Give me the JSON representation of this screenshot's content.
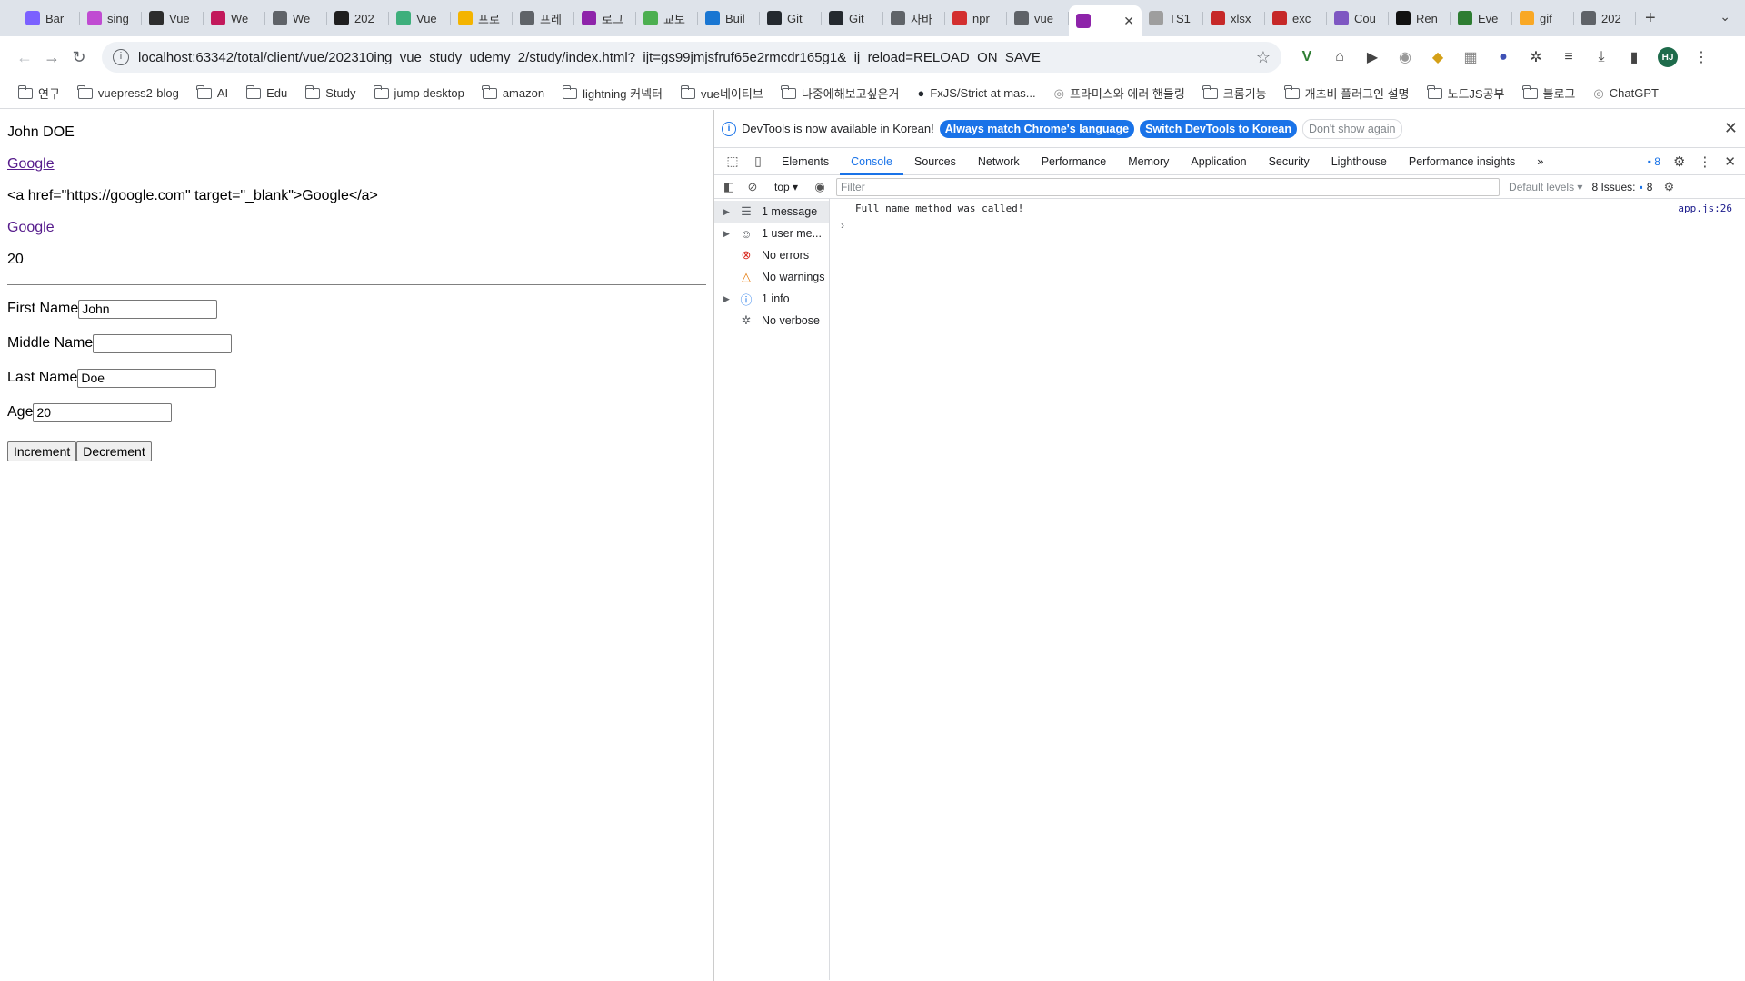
{
  "tabs": [
    {
      "label": "Bar",
      "color": "#7b61ff"
    },
    {
      "label": "sing",
      "color": "#c04bd2"
    },
    {
      "label": "Vue",
      "color": "#2d2d2d"
    },
    {
      "label": "We",
      "color": "#c2185b"
    },
    {
      "label": "We",
      "color": "#5f6368"
    },
    {
      "label": "202",
      "color": "#1f1f1f"
    },
    {
      "label": "Vue",
      "color": "#3eaf7c"
    },
    {
      "label": "프로",
      "color": "#f4b400"
    },
    {
      "label": "프레",
      "color": "#5f6368"
    },
    {
      "label": "로그",
      "color": "#8e24aa"
    },
    {
      "label": "교보",
      "color": "#4caf50"
    },
    {
      "label": "Buil",
      "color": "#1976d2"
    },
    {
      "label": "Git",
      "color": "#24292f"
    },
    {
      "label": "Git",
      "color": "#24292f"
    },
    {
      "label": "자바",
      "color": "#5f6368"
    },
    {
      "label": "npr",
      "color": "#d32f2f"
    },
    {
      "label": "vue",
      "color": "#5f6368"
    },
    {
      "label": "",
      "color": "#8e24aa",
      "active": true
    },
    {
      "label": "TS1",
      "color": "#9e9e9e"
    },
    {
      "label": "xlsx",
      "color": "#c62828"
    },
    {
      "label": "exc",
      "color": "#c62828"
    },
    {
      "label": "Cou",
      "color": "#7e57c2"
    },
    {
      "label": "Ren",
      "color": "#111111"
    },
    {
      "label": "Eve",
      "color": "#2e7d32"
    },
    {
      "label": "gif",
      "color": "#f9a825"
    },
    {
      "label": "202",
      "color": "#5f6368"
    }
  ],
  "address": {
    "url": "localhost:63342/total/client/vue/202310ing_vue_study_udemy_2/study/index.html?_ijt=gs99jmjsfruf65e2rmcdr165g1&_ij_reload=RELOAD_ON_SAVE"
  },
  "bookmarks": [
    {
      "label": "연구",
      "type": "folder"
    },
    {
      "label": "vuepress2-blog",
      "type": "folder"
    },
    {
      "label": "AI",
      "type": "folder"
    },
    {
      "label": "Edu",
      "type": "folder"
    },
    {
      "label": "Study",
      "type": "folder"
    },
    {
      "label": "jump desktop",
      "type": "folder"
    },
    {
      "label": "amazon",
      "type": "folder"
    },
    {
      "label": "lightning 커넥터",
      "type": "folder"
    },
    {
      "label": "vue네이티브",
      "type": "folder"
    },
    {
      "label": "나중에해보고싶은거",
      "type": "folder"
    },
    {
      "label": "FxJS/Strict at mas...",
      "type": "github"
    },
    {
      "label": "프라미스와 에러 핸들링",
      "type": "site"
    },
    {
      "label": "크롬기능",
      "type": "folder"
    },
    {
      "label": "개츠비 플러그인 설명",
      "type": "folder"
    },
    {
      "label": "노드JS공부",
      "type": "folder"
    },
    {
      "label": "블로그",
      "type": "folder"
    },
    {
      "label": "ChatGPT",
      "type": "site"
    }
  ],
  "page": {
    "full_name": "John DOE",
    "link1": "Google",
    "raw_html": "<a href=\"https://google.com\" target=\"_blank\">Google</a>",
    "link2": "Google",
    "age_display": "20",
    "first_label": "First Name",
    "first_value": "John",
    "middle_label": "Middle Name",
    "middle_value": "",
    "last_label": "Last Name",
    "last_value": "Doe",
    "age_label": "Age",
    "age_value": "20",
    "inc_label": "Increment",
    "dec_label": "Decrement"
  },
  "devtools": {
    "banner_text": "DevTools is now available in Korean!",
    "banner_btn1": "Always match Chrome's language",
    "banner_btn2": "Switch DevTools to Korean",
    "banner_btn3": "Don't show again",
    "tabs": [
      "Elements",
      "Console",
      "Sources",
      "Network",
      "Performance",
      "Memory",
      "Application",
      "Security",
      "Lighthouse",
      "Performance insights"
    ],
    "active_tab": "Console",
    "msg_count": "8",
    "context": "top",
    "filter_placeholder": "Filter",
    "levels": "Default levels",
    "issues_label": "8 Issues:",
    "issues_count": "8",
    "sidebar": [
      {
        "label": "1 message",
        "icon": "list-icon",
        "arrow": true,
        "selected": true
      },
      {
        "label": "1 user me...",
        "icon": "user-icon",
        "arrow": true
      },
      {
        "label": "No errors",
        "icon": "error-icon",
        "arrow": false
      },
      {
        "label": "No warnings",
        "icon": "warning-icon",
        "arrow": false
      },
      {
        "label": "1 info",
        "icon": "info-icon",
        "arrow": true
      },
      {
        "label": "No verbose",
        "icon": "bug-icon",
        "arrow": false
      }
    ],
    "log": {
      "text": "Full name method was called!",
      "source": "app.js:26"
    }
  }
}
